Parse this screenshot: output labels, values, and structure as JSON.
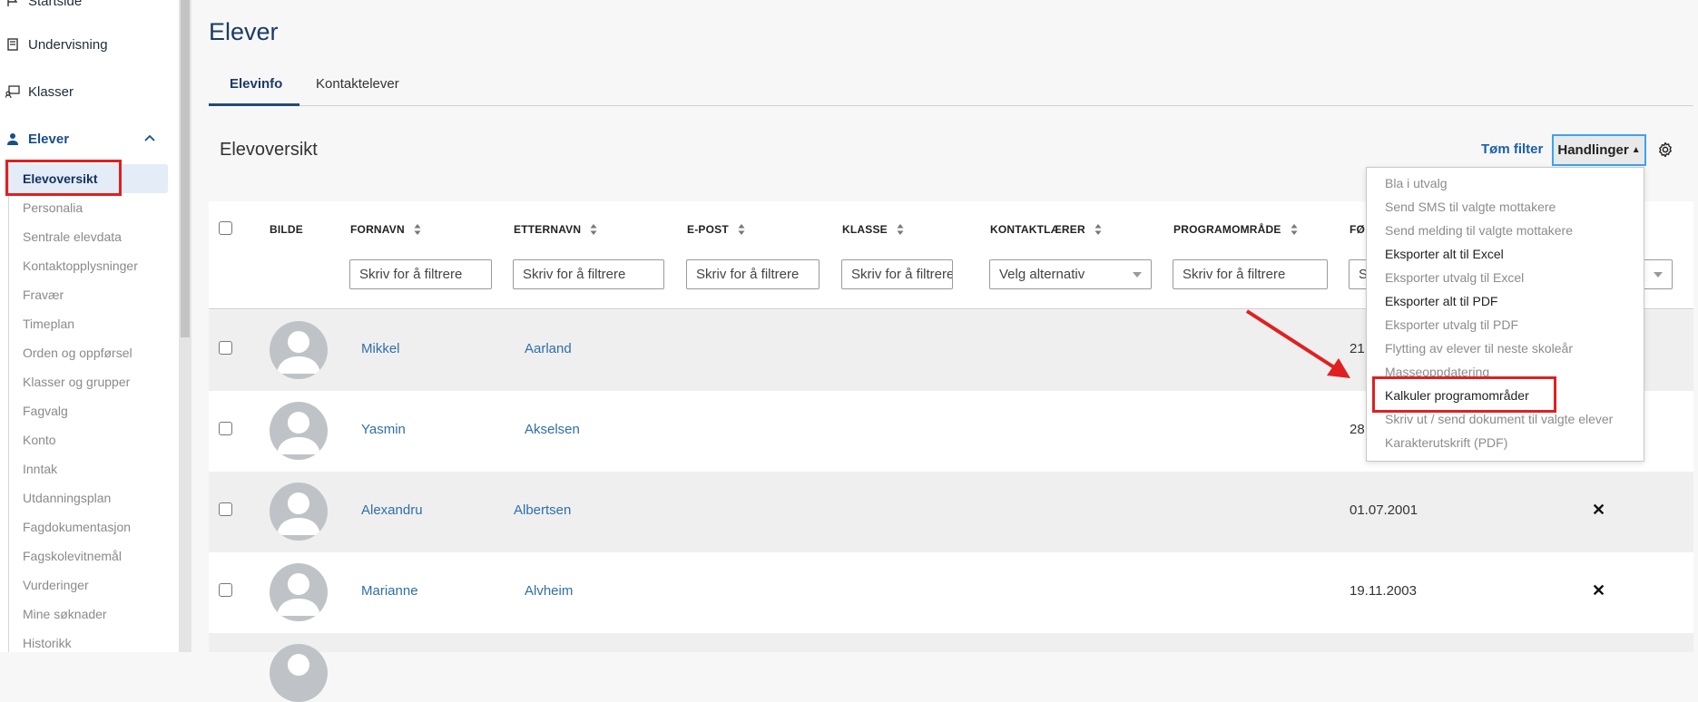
{
  "sidebar": {
    "items": [
      {
        "label": "Startside",
        "icon": "flag-icon"
      },
      {
        "label": "Undervisning",
        "icon": "book-icon"
      },
      {
        "label": "Klasser",
        "icon": "classroom-icon"
      },
      {
        "label": "Elever",
        "icon": "student-icon"
      }
    ],
    "sub_items": [
      "Elevoversikt",
      "Personalia",
      "Sentrale elevdata",
      "Kontaktopplysninger",
      "Fravær",
      "Timeplan",
      "Orden og oppførsel",
      "Klasser og grupper",
      "Fagvalg",
      "Konto",
      "Inntak",
      "Utdanningsplan",
      "Fagdokumentasjon",
      "Fagskolevitnemål",
      "Vurderinger",
      "Mine søknader",
      "Historikk"
    ]
  },
  "page": {
    "title": "Elever",
    "tabs": [
      "Elevinfo",
      "Kontaktelever"
    ],
    "section_title": "Elevoversikt",
    "clear_filter": "Tøm filter",
    "actions_label": "Handlinger"
  },
  "table": {
    "headers": [
      "BILDE",
      "FORNAVN",
      "ETTERNAVN",
      "E-POST",
      "KLASSE",
      "KONTAKTLÆRER",
      "PROGRAMOMRÅDE",
      "FØ"
    ],
    "filter_placeholders": {
      "fornavn": "Skriv for å filtrere",
      "etternavn": "Skriv for å filtrere",
      "epost": "Skriv for å filtrere",
      "klasse": "Skriv for å filtrere",
      "kontaktlaerer": "Velg alternativ",
      "programomrade": "Skriv for å filtrere",
      "fodt": "S"
    },
    "rows": [
      {
        "fornavn": "Mikkel",
        "etternavn": "Aarland",
        "fodt": "21",
        "x": ""
      },
      {
        "fornavn": "Yasmin",
        "etternavn": "Akselsen",
        "fodt": "28",
        "x": ""
      },
      {
        "fornavn": "Alexandru",
        "etternavn": "Albertsen",
        "fodt": "01.07.2001",
        "x": "✕"
      },
      {
        "fornavn": "Marianne",
        "etternavn": "Alvheim",
        "fodt": "19.11.2003",
        "x": "✕"
      }
    ]
  },
  "dropdown": {
    "items": [
      {
        "label": "Bla i utvalg",
        "enabled": false
      },
      {
        "label": "Send SMS til valgte mottakere",
        "enabled": false
      },
      {
        "label": "Send melding til valgte mottakere",
        "enabled": false
      },
      {
        "label": "Eksporter alt til Excel",
        "enabled": true
      },
      {
        "label": "Eksporter utvalg til Excel",
        "enabled": false
      },
      {
        "label": "Eksporter alt til PDF",
        "enabled": true
      },
      {
        "label": "Eksporter utvalg til PDF",
        "enabled": false
      },
      {
        "label": "Flytting av elever til neste skoleår",
        "enabled": false
      },
      {
        "label": "Masseoppdatering",
        "enabled": false
      },
      {
        "label": "Kalkuler programområder",
        "enabled": true
      },
      {
        "label": "Skriv ut / send dokument til valgte elever",
        "enabled": false
      },
      {
        "label": "Karakterutskrift (PDF)",
        "enabled": false
      }
    ]
  },
  "colors": {
    "accent": "#1b3b63",
    "link": "#2f6fa8",
    "highlight": "#e02020",
    "focus": "#3ba4ee"
  }
}
